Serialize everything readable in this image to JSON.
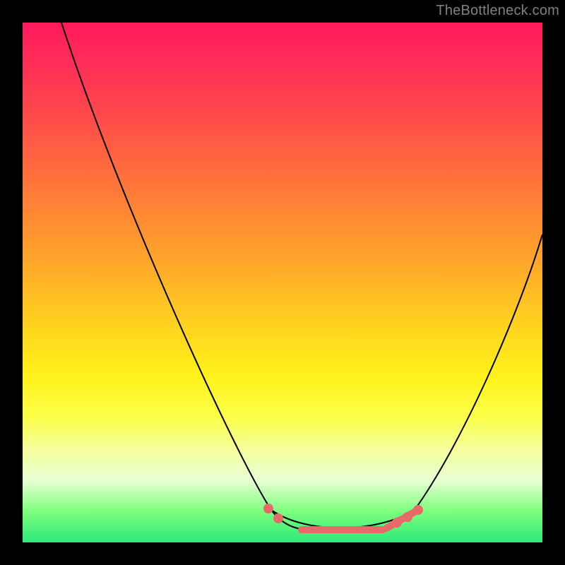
{
  "watermark": "TheBottleneck.com",
  "chart_data": {
    "type": "line",
    "title": "",
    "xlabel": "",
    "ylabel": "",
    "xlim": [
      0,
      100
    ],
    "ylim": [
      0,
      100
    ],
    "grid": false,
    "legend": false,
    "background_gradient_stops": [
      {
        "pos": 0.0,
        "color": "#ff1a5c"
      },
      {
        "pos": 0.5,
        "color": "#ffd21f"
      },
      {
        "pos": 0.8,
        "color": "#fbff4a"
      },
      {
        "pos": 1.0,
        "color": "#2ee87a"
      }
    ],
    "series": [
      {
        "name": "bottleneck-curve",
        "color": "#000000",
        "x": [
          7,
          15,
          25,
          35,
          45,
          48,
          52,
          58,
          65,
          72,
          76,
          82,
          90,
          100
        ],
        "y": [
          100,
          80,
          58,
          38,
          12,
          6,
          2,
          2,
          2,
          6,
          12,
          28,
          50,
          60
        ]
      },
      {
        "name": "highlighted-valley",
        "color": "#e86a68",
        "style": "dots+segments",
        "x": [
          47,
          49,
          54,
          62,
          69,
          72,
          74,
          76
        ],
        "y": [
          6,
          4,
          2,
          2,
          2,
          4,
          5,
          6
        ]
      }
    ],
    "annotations": [
      {
        "text": "TheBottleneck.com",
        "position": "top-right",
        "color": "#808080"
      }
    ]
  }
}
